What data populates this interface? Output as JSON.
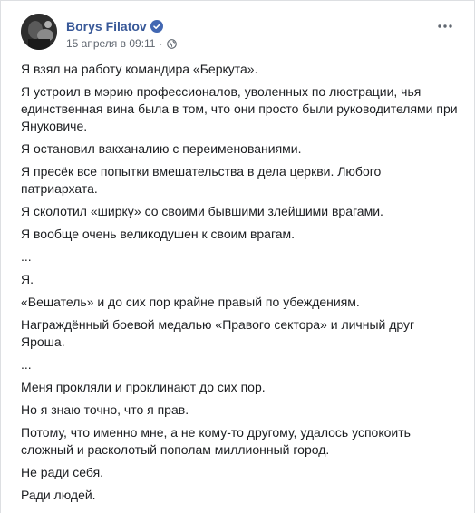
{
  "post": {
    "author": "Borys Filatov",
    "timestamp": "15 апреля в 09:11",
    "separator": "·",
    "icons": {
      "verified": "verified-badge-icon",
      "privacy": "globe-icon",
      "more": "more-options-icon"
    },
    "colors": {
      "author": "#385898",
      "verified": "#4267b2",
      "meta": "#606770"
    },
    "paragraphs": [
      "Я взял на работу командира «Беркута».",
      "Я устроил в мэрию профессионалов, уволенных по люстрации, чья единственная вина была в том, что они просто были руководителями при Януковиче.",
      "Я остановил вакханалию с переименованиями.",
      "Я пресёк все попытки вмешательства в дела церкви. Любого патриархата.",
      "Я сколотил «ширку» со своими бывшими злейшими врагами.",
      "Я вообще очень великодушен к своим врагам.",
      "...",
      "Я.",
      "«Вешатель» и до сих пор крайне правый по убеждениям.",
      "Награждённый боевой медалью «Правого сектора» и личный друг Яроша.",
      "...",
      "Меня прокляли и проклинают до сих пор.",
      "Но я знаю точно, что я прав.",
      "Потому, что именно мне, а не кому-то другому, удалось успокоить сложный и расколотый пополам миллионный город.",
      "Не ради себя.",
      "Ради людей."
    ]
  }
}
